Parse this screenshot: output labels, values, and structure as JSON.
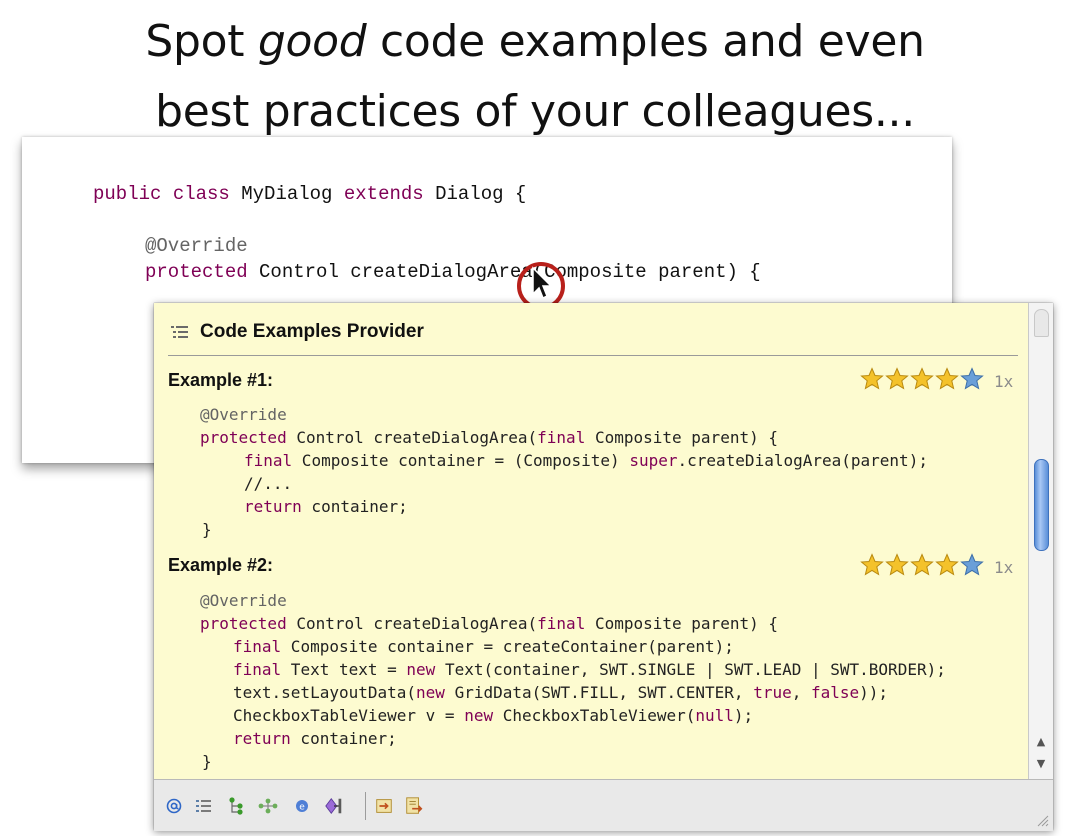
{
  "headline": {
    "line1_before": "Spot ",
    "line1_emph": "good",
    "line1_after": " code examples and even",
    "line2": "best practices of your colleagues..."
  },
  "editor": {
    "line1": {
      "kw1": "public",
      "kw2": "class",
      "name": " MyDialog ",
      "kw3": "extends",
      "rest": " Dialog {"
    },
    "line2": {
      "annotation": "@Override"
    },
    "line3": {
      "kw": "protected",
      "rest": " Control createDialogArea(Composite parent) {"
    }
  },
  "popup": {
    "title": "Code Examples Provider",
    "examples": [
      {
        "label": "Example #1:",
        "rating": 4.5,
        "count": "1x",
        "lines": [
          {
            "t": "@Override"
          },
          {
            "kw": "protected",
            "r1": " Control createDialogArea(",
            "kw2": "final",
            "r2": " Composite parent) {"
          },
          {
            "kw": "final",
            "r1": " Composite container = (Composite) ",
            "kw2": "super",
            "r2": ".createDialogArea(parent);"
          },
          {
            "t": "//..."
          },
          {
            "kw": "return",
            "r1": " container;"
          },
          {
            "t": "}"
          }
        ]
      },
      {
        "label": "Example #2:",
        "rating": 4.5,
        "count": "1x",
        "lines": [
          {
            "t": "@Override"
          },
          {
            "kw": "protected",
            "r1": " Control createDialogArea(",
            "kw2": "final",
            "r2": " Composite parent) {"
          },
          {
            "kw": "final",
            "r1": " Composite container = createContainer(parent);"
          },
          {
            "kw": "final",
            "r1": " Text text = ",
            "kw2": "new",
            "r2": " Text(container, SWT.SINGLE | SWT.LEAD | SWT.BORDER);"
          },
          {
            "r0": "text.setLayoutData(",
            "kw": "new",
            "r1": " GridData(SWT.FILL, SWT.CENTER, ",
            "kw2": "true",
            "r2": ", ",
            "kw3": "false",
            "r3": "));"
          },
          {
            "r0": "CheckboxTableViewer v = ",
            "kw": "new",
            "r1": " CheckboxTableViewer(",
            "kw2": "null",
            "r2": ");"
          },
          {
            "kw": "return",
            "r1": " container;"
          },
          {
            "t": "}"
          }
        ]
      }
    ],
    "toolbar_icons": [
      "at-icon",
      "list-icon",
      "hierarchy-icon",
      "branch-icon",
      "circle-e-icon",
      "diamond-arrow-icon",
      "import-icon",
      "export-icon"
    ],
    "colors": {
      "keyword": "#7f0055",
      "popup_bg": "#fdfbd0",
      "cursor_ring": "#b8201b"
    }
  }
}
